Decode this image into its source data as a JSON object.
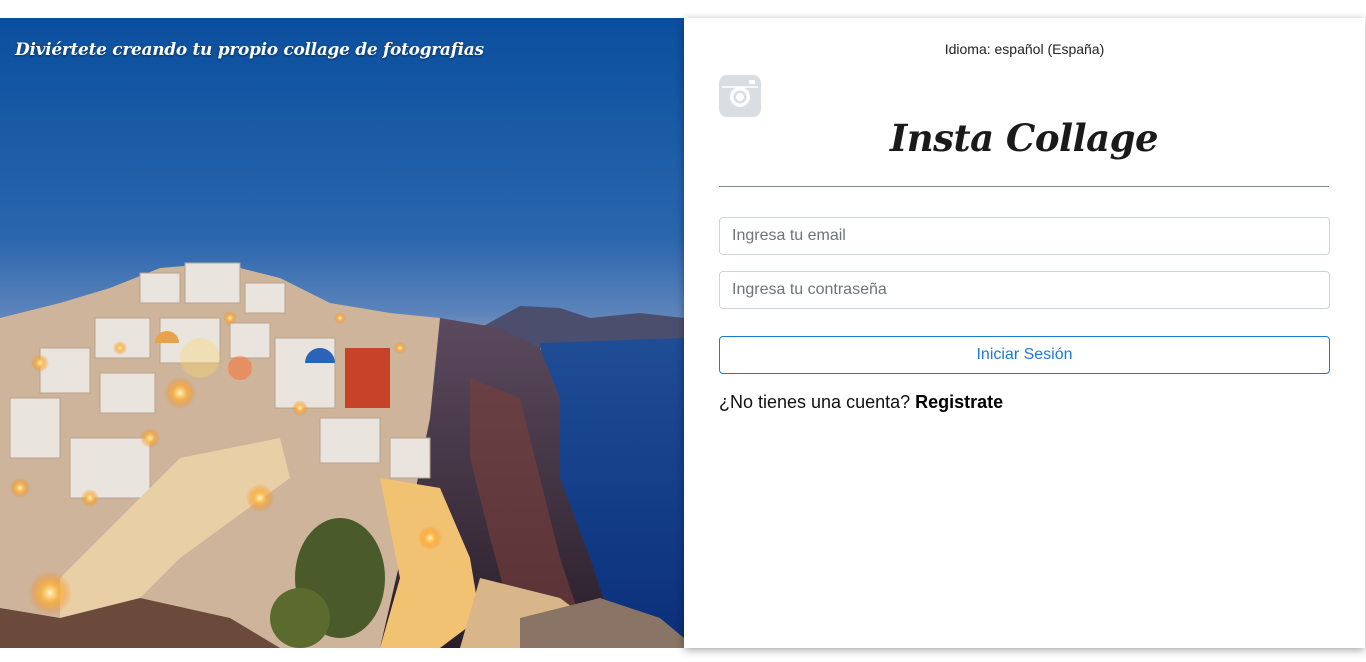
{
  "hero": {
    "tagline": "Diviértete creando tu propio collage de fotografias",
    "image_alt": "Santorini village at dusk"
  },
  "login": {
    "language_label": "Idioma: español (España)",
    "app_title": "Insta Collage",
    "logo_icon": "instagram-camera-icon",
    "email_placeholder": "Ingresa tu email",
    "password_placeholder": "Ingresa tu contraseña",
    "login_button": "Iniciar Sesión",
    "no_account_prompt": "¿No tienes una cuenta?",
    "register_link": "Registrate"
  },
  "colors": {
    "accent": "#1b7bd4",
    "logo_gray": "#d9dee3",
    "divider": "#7c8e93"
  }
}
